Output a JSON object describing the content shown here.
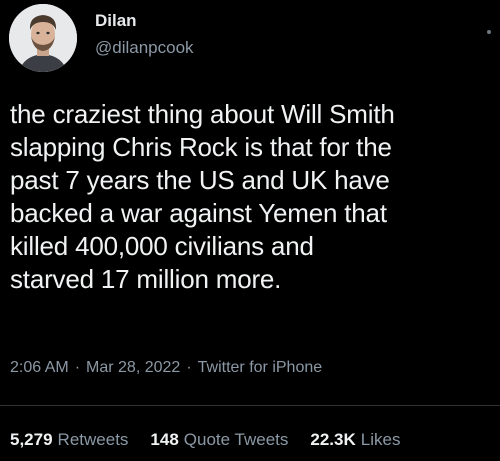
{
  "author": {
    "display_name": "Dilan",
    "handle": "@dilanpcook"
  },
  "tweet": {
    "text": "the craziest thing about Will Smith\nslapping Chris Rock is that for the\npast 7 years the US and UK have\nbacked a war against Yemen that\nkilled 400,000 civilians and\nstarved 17 million more."
  },
  "meta": {
    "time": "2:06 AM",
    "separator": "·",
    "date": "Mar 28, 2022",
    "source": "Twitter for iPhone"
  },
  "stats": {
    "retweets_count": "5,279",
    "retweets_label": "Retweets",
    "quotes_count": "148",
    "quotes_label": "Quote Tweets",
    "likes_count": "22.3K",
    "likes_label": "Likes"
  },
  "colors": {
    "background": "#000000",
    "text_primary": "#e7e9ea",
    "text_secondary": "#8b98a5",
    "divider": "#2f3336"
  }
}
